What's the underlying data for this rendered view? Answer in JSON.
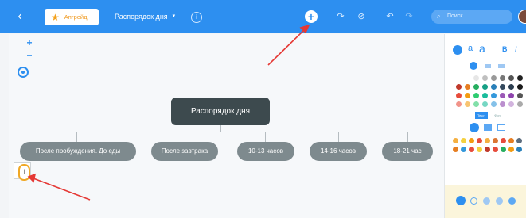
{
  "topbar": {
    "upgrade_label": "Апгрейд",
    "map_title": "Распорядок дня",
    "search_placeholder": "Поиск",
    "icons": [
      "back-icon",
      "star-icon",
      "caret-down-icon",
      "info-icon",
      "add-icon",
      "relation-icon",
      "cancel-icon",
      "undo-icon",
      "redo-icon",
      "search-icon",
      "avatar"
    ]
  },
  "canvas": {
    "central_topic": "Распорядок дня",
    "subtopics": [
      "После пробуждения. До еды",
      "После завтрака",
      "10-13 часов",
      "14-16 часов",
      "18-21 час"
    ],
    "info_badge": "i",
    "zoom_in": "+",
    "zoom_out": "−"
  },
  "panel": {
    "text_style": {
      "aa_small": "a",
      "aa_large": "a",
      "bold": "B",
      "italic": "I"
    },
    "tabs": [
      "Текст",
      "Фон"
    ],
    "colors": {
      "accent": "#2d8ff0",
      "topbar": "#2d8ff0",
      "central_node": "#3d4a4e",
      "subtopic_node": "#7e8a8e",
      "highlight_badge": "#f0a825",
      "annotation_arrow": "#e53935"
    }
  }
}
